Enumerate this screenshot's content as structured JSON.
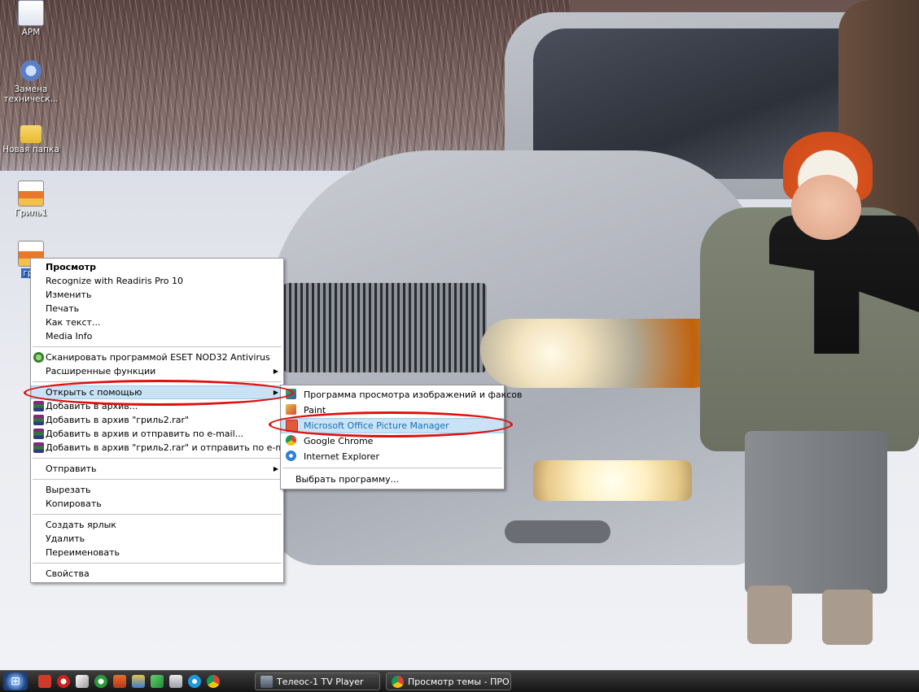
{
  "desktop": {
    "icons": [
      {
        "label": "АРМ"
      },
      {
        "label": "Замена техническ..."
      },
      {
        "label": "Новая папка"
      },
      {
        "label": "Гриль1"
      },
      {
        "label": "гри"
      }
    ]
  },
  "context_menu": {
    "items": [
      {
        "label": "Просмотр"
      },
      {
        "label": "Recognize with Readiris Pro 10"
      },
      {
        "label": "Изменить"
      },
      {
        "label": "Печать"
      },
      {
        "label": "Как текст..."
      },
      {
        "label": "Media Info"
      },
      {
        "label": "Сканировать программой ESET NOD32 Antivirus"
      },
      {
        "label": "Расширенные функции"
      },
      {
        "label": "Открыть с помощью"
      },
      {
        "label": "Добавить в архив..."
      },
      {
        "label": "Добавить в архив \"гриль2.rar\""
      },
      {
        "label": "Добавить в архив и отправить по e-mail..."
      },
      {
        "label": "Добавить в архив \"гриль2.rar\" и отправить по e-mail"
      },
      {
        "label": "Отправить"
      },
      {
        "label": "Вырезать"
      },
      {
        "label": "Копировать"
      },
      {
        "label": "Создать ярлык"
      },
      {
        "label": "Удалить"
      },
      {
        "label": "Переименовать"
      },
      {
        "label": "Свойства"
      }
    ]
  },
  "open_with_submenu": {
    "items": [
      {
        "label": "Программа просмотра изображений и факсов"
      },
      {
        "label": "Paint"
      },
      {
        "label": "Microsoft Office Picture Manager"
      },
      {
        "label": "Google Chrome"
      },
      {
        "label": "Internet Explorer"
      },
      {
        "label": "Выбрать программу..."
      }
    ]
  },
  "taskbar": {
    "tasks": [
      {
        "label": "Телеос-1 TV Player"
      },
      {
        "label": "Просмотр темы - ПРО..."
      }
    ]
  },
  "colors": {
    "highlight": "#c8e3f5",
    "annotation": "#e01010",
    "submenu_highlight_text": "#1a6fb5"
  }
}
